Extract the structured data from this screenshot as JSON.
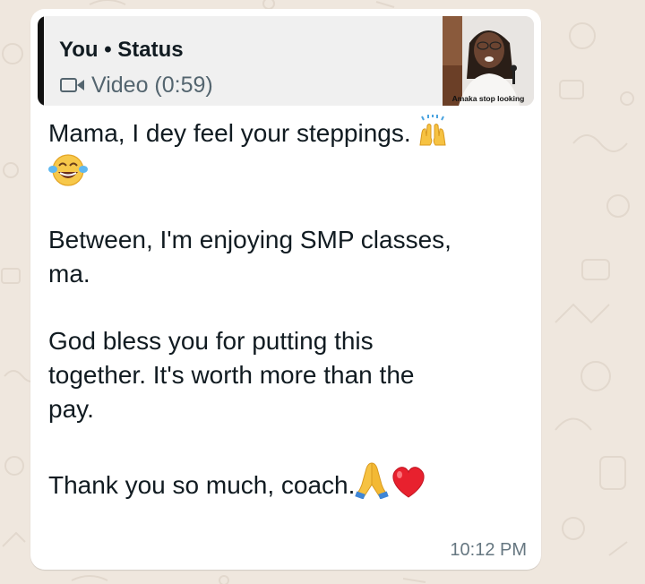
{
  "quoted_status": {
    "title": "You • Status",
    "subtitle": "Video (0:59)",
    "thumbnail_caption": "Amaka stop looking",
    "icon": "video-camera-icon"
  },
  "message": {
    "line1": "Mama, I dey feel your steppings.",
    "line2": "Between, I'm enjoying SMP classes,",
    "line3": "ma.",
    "line4": "God bless you for putting this",
    "line5": "together. It's worth more than the",
    "line6": "pay.",
    "line7": "Thank you so much, coach.",
    "emojis": [
      "raising-hands-icon",
      "tears-of-joy-icon",
      "folded-hands-icon",
      "red-heart-icon"
    ]
  },
  "timestamp": "10:12 PM",
  "colors": {
    "bubble": "#ffffff",
    "quote_background": "#f0f0f0",
    "quote_bar": "#111111",
    "wallpaper": "#efe7de",
    "timestamp": "#667781"
  }
}
